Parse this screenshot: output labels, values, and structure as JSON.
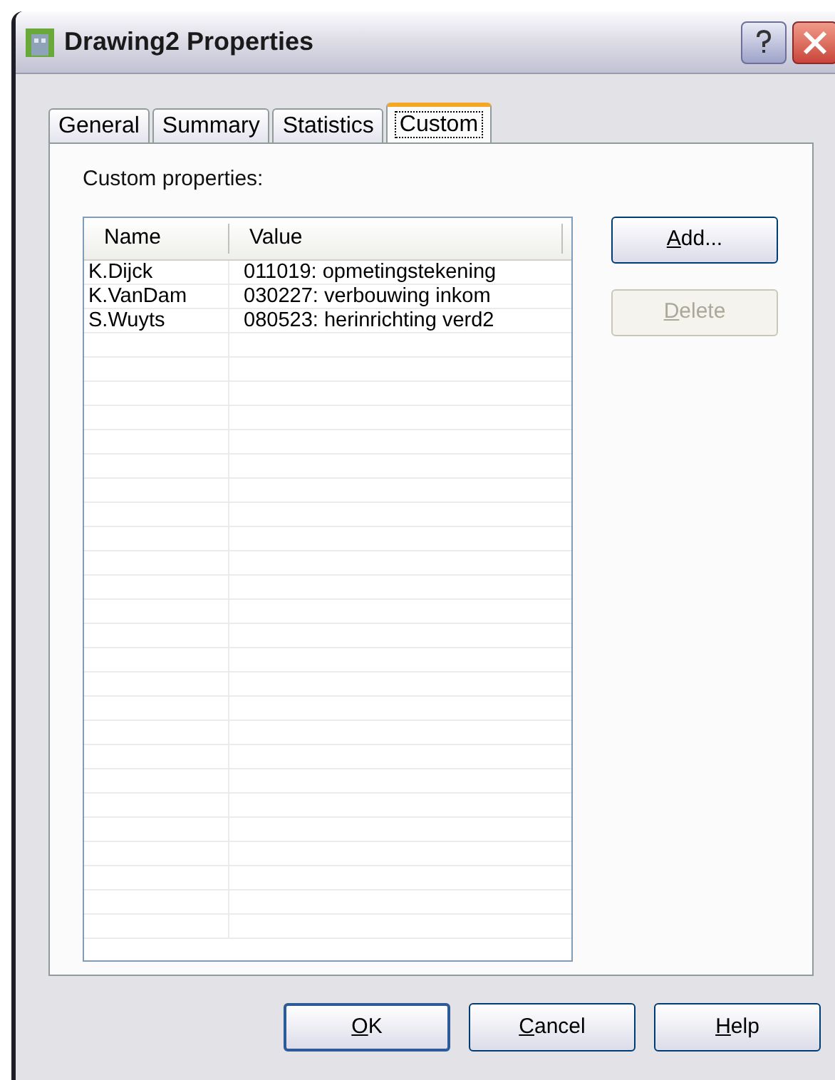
{
  "window": {
    "title": "Drawing2 Properties"
  },
  "tabs": [
    {
      "label": "General",
      "selected": false
    },
    {
      "label": "Summary",
      "selected": false
    },
    {
      "label": "Statistics",
      "selected": false
    },
    {
      "label": "Custom",
      "selected": true
    }
  ],
  "section_label": "Custom properties:",
  "table": {
    "columns": [
      "Name",
      "Value"
    ],
    "rows": [
      [
        "K.Dijck",
        "011019: opmetingstekening"
      ],
      [
        "K.VanDam",
        "030227: verbouwing inkom"
      ],
      [
        "S.Wuyts",
        "080523: herinrichting verd2"
      ]
    ]
  },
  "side_buttons": [
    {
      "label": "Add...",
      "mnemonic": true,
      "disabled": false
    },
    {
      "label": "Delete",
      "mnemonic": true,
      "disabled": true
    }
  ],
  "buttons": [
    {
      "label": "OK",
      "mnemonic": true
    },
    {
      "label": "Cancel",
      "mnemonic": true
    },
    {
      "label": "Help",
      "mnemonic": true
    }
  ]
}
